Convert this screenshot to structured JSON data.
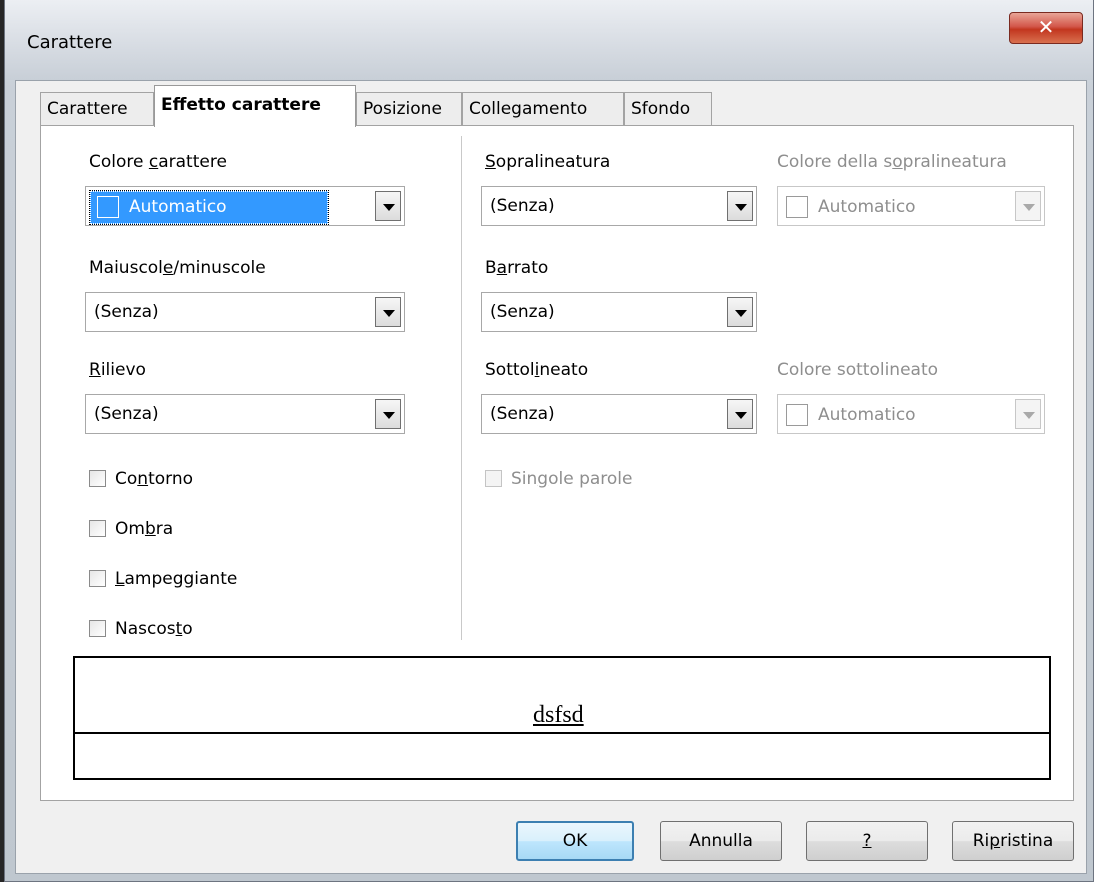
{
  "window": {
    "title": "Carattere",
    "close_glyph": "✕"
  },
  "tabs": [
    {
      "label": "Carattere"
    },
    {
      "label": "Effetto carattere"
    },
    {
      "label": "Posizione"
    },
    {
      "label": "Collegamento"
    },
    {
      "label": "Sfondo"
    }
  ],
  "left": {
    "font_color": {
      "label_pre": "Colore ",
      "label_u": "c",
      "label_post": "arattere",
      "value": "Automatico"
    },
    "case": {
      "label_pre": "Maiuscol",
      "label_u": "e",
      "label_post": "/minuscole",
      "value": "(Senza)"
    },
    "relief": {
      "label_pre": "",
      "label_u": "R",
      "label_post": "ilievo",
      "value": "(Senza)"
    },
    "checkboxes": {
      "outline": {
        "pre": "Co",
        "u": "n",
        "post": "torno",
        "checked": false
      },
      "shadow": {
        "pre": "Om",
        "u": "b",
        "post": "ra",
        "checked": false
      },
      "blinking": {
        "pre": "",
        "u": "L",
        "post": "ampeggiante",
        "checked": false
      },
      "hidden": {
        "pre": "Nascos",
        "u": "t",
        "post": "o",
        "checked": false
      }
    }
  },
  "right": {
    "overline": {
      "label_pre": "",
      "label_u": "S",
      "label_post": "opralineatura",
      "value": "(Senza)"
    },
    "overline_color": {
      "label_pre": "Colore della s",
      "label_u": "o",
      "label_post": "pralineatura",
      "value": "Automatico"
    },
    "strikethrough": {
      "label_pre": "B",
      "label_u": "a",
      "label_post": "rrato",
      "value": "(Senza)"
    },
    "underline": {
      "label_pre": "Sottol",
      "label_u": "i",
      "label_post": "neato",
      "value": "(Senza)"
    },
    "underline_color": {
      "label": "Colore sottolineato",
      "value": "Automatico"
    },
    "individual_words": {
      "pre": "Sin",
      "u": "g",
      "post": "ole parole",
      "checked": false
    }
  },
  "preview": {
    "text": "dsfsd"
  },
  "buttons": {
    "ok": "OK",
    "cancel": "Annulla",
    "help": "?",
    "reset_pre": "Ri",
    "reset_u": "p",
    "reset_post": "ristina"
  },
  "colors": {
    "selection": "#3399ff",
    "close_button": "#c2361f"
  }
}
